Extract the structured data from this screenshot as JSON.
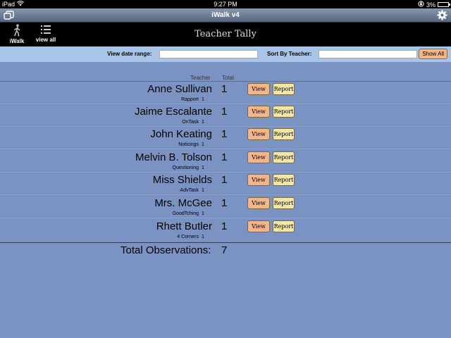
{
  "status": {
    "device": "iPad",
    "time": "9:27 PM",
    "battery": "3%"
  },
  "titlebar": {
    "title": "iWalk v4",
    "left_icon": "window-copy-icon",
    "right_icon": "gear-icon"
  },
  "toolbar": {
    "tools": [
      {
        "label": "iWalk",
        "icon": "walking-person-icon"
      },
      {
        "label": "view all",
        "icon": "list-icon"
      }
    ],
    "page_title": "Teacher Tally"
  },
  "filters": {
    "date_label": "View date range:",
    "date_value": "",
    "teacher_label": "Sort By Teacher:",
    "teacher_value": "",
    "show_all_label": "Show All"
  },
  "table": {
    "col_teacher": "Teacher",
    "col_total": "Total",
    "view_label": "View",
    "report_label": "Report",
    "rows": [
      {
        "name": "Anne Sullivan",
        "total": "1",
        "sub_label": "Rapport",
        "sub_count": "1"
      },
      {
        "name": "Jaime Escalante",
        "total": "1",
        "sub_label": "OnTask",
        "sub_count": "1"
      },
      {
        "name": "John Keating",
        "total": "1",
        "sub_label": "Noticings",
        "sub_count": "1"
      },
      {
        "name": "Melvin B. Tolson",
        "total": "1",
        "sub_label": "Questioning",
        "sub_count": "1"
      },
      {
        "name": "Miss Shields",
        "total": "1",
        "sub_label": "AdvTask",
        "sub_count": "1"
      },
      {
        "name": "Mrs. McGee",
        "total": "1",
        "sub_label": "GoodTching",
        "sub_count": "1"
      },
      {
        "name": "Rhett Butler",
        "total": "1",
        "sub_label": "4 Corners",
        "sub_count": "1"
      }
    ]
  },
  "totals": {
    "label": "Total Observations:",
    "value": "7"
  }
}
